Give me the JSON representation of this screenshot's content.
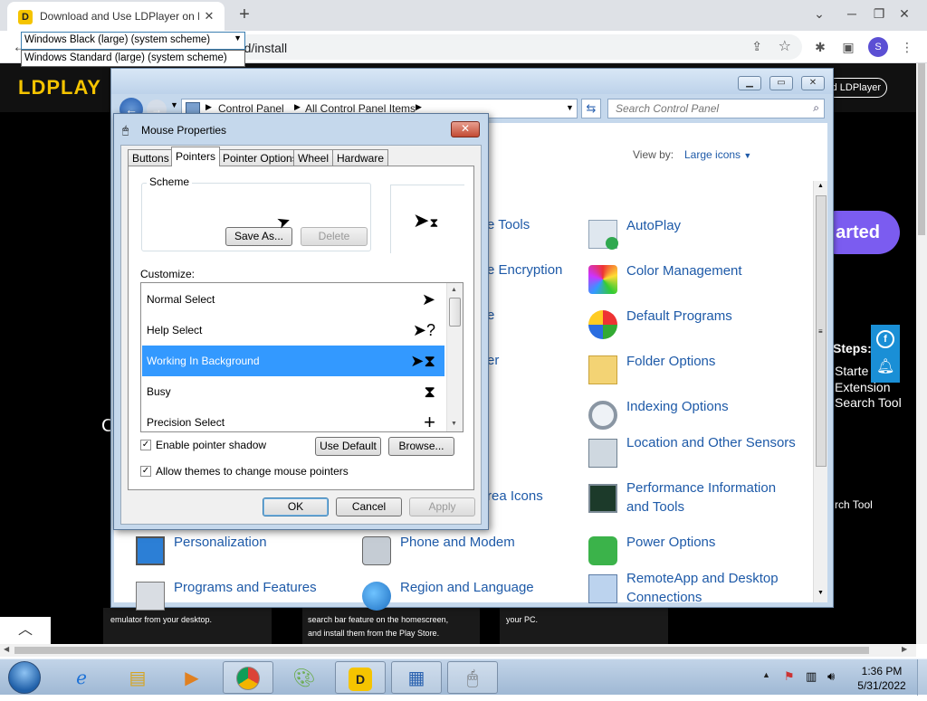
{
  "browser": {
    "tab_title": "Download and Use LDPlayer on PC",
    "tab_close": "✕",
    "new_tab": "+",
    "url": "ldplayer.net/download/install",
    "avatar_letter": "S",
    "window_controls": [
      "⌄",
      "─",
      "❐",
      "✕"
    ]
  },
  "page": {
    "logo": "LDPLAY",
    "download_pill": "d LDPlayer",
    "started_button": "arted",
    "steps_heading": "Steps:",
    "steps_lines": [
      "Starte",
      "Extension",
      "Search Tool"
    ],
    "search_tool": "rch Tool",
    "left_char": "C",
    "bottom_texts": [
      "emulator from your desktop.",
      "search bar feature on the homescreen,",
      "and install them from the Play Store.",
      "your PC."
    ],
    "scroll_up": "^"
  },
  "control_panel": {
    "breadcrumb": [
      "Control Panel",
      "All Control Panel Items"
    ],
    "search_placeholder": "Search Control Panel",
    "view_by_label": "View by:",
    "view_by_value": "Large icons",
    "partial_items": [
      "e Tools",
      "e Encryption",
      "e",
      "er",
      "rea Icons"
    ],
    "items_right": [
      {
        "label": "AutoPlay",
        "icon": "autoplay-icon"
      },
      {
        "label": "Color Management",
        "icon": "color-management-icon"
      },
      {
        "label": "Default Programs",
        "icon": "default-programs-icon"
      },
      {
        "label": "Folder Options",
        "icon": "folder-options-icon"
      },
      {
        "label": "Indexing Options",
        "icon": "indexing-options-icon"
      },
      {
        "label": "Location and Other Sensors",
        "icon": "location-sensors-icon"
      },
      {
        "label": "Performance Information and Tools",
        "icon": "performance-icon"
      },
      {
        "label": "Power Options",
        "icon": "power-options-icon"
      },
      {
        "label": "RemoteApp and Desktop Connections",
        "icon": "remoteapp-icon"
      }
    ],
    "items_left": [
      {
        "label": "Personalization",
        "icon": "personalization-icon"
      },
      {
        "label": "Programs and Features",
        "icon": "programs-features-icon"
      }
    ],
    "items_mid": [
      {
        "label": "Phone and Modem",
        "icon": "phone-modem-icon"
      },
      {
        "label": "Region and Language",
        "icon": "region-language-icon"
      }
    ]
  },
  "mouse_properties": {
    "title": "Mouse Properties",
    "tabs": [
      "Buttons",
      "Pointers",
      "Pointer Options",
      "Wheel",
      "Hardware"
    ],
    "active_tab": "Pointers",
    "scheme_label": "Scheme",
    "scheme_selected": "Windows Black (large) (system scheme)",
    "scheme_dropdown_option": "Windows Standard (large) (system scheme)",
    "save_as": "Save As...",
    "delete": "Delete",
    "customize_label": "Customize:",
    "pointers": [
      {
        "name": "Normal Select",
        "cursor": "arrow-cursor",
        "glyph": "➤",
        "selected": false
      },
      {
        "name": "Help Select",
        "cursor": "help-cursor",
        "glyph": "➤?",
        "selected": false
      },
      {
        "name": "Working In Background",
        "cursor": "working-cursor",
        "glyph": "➤⧗",
        "selected": true
      },
      {
        "name": "Busy",
        "cursor": "busy-cursor",
        "glyph": "⧗",
        "selected": false
      },
      {
        "name": "Precision Select",
        "cursor": "crosshair-cursor",
        "glyph": "+",
        "selected": false
      }
    ],
    "enable_shadow_label": "Enable pointer shadow",
    "enable_shadow_checked": true,
    "allow_themes_label": "Allow themes to change mouse pointers",
    "allow_themes_checked": true,
    "use_default": "Use Default",
    "browse": "Browse...",
    "ok": "OK",
    "cancel": "Cancel",
    "apply": "Apply"
  },
  "taskbar": {
    "time": "1:36 PM",
    "date": "5/31/2022"
  }
}
